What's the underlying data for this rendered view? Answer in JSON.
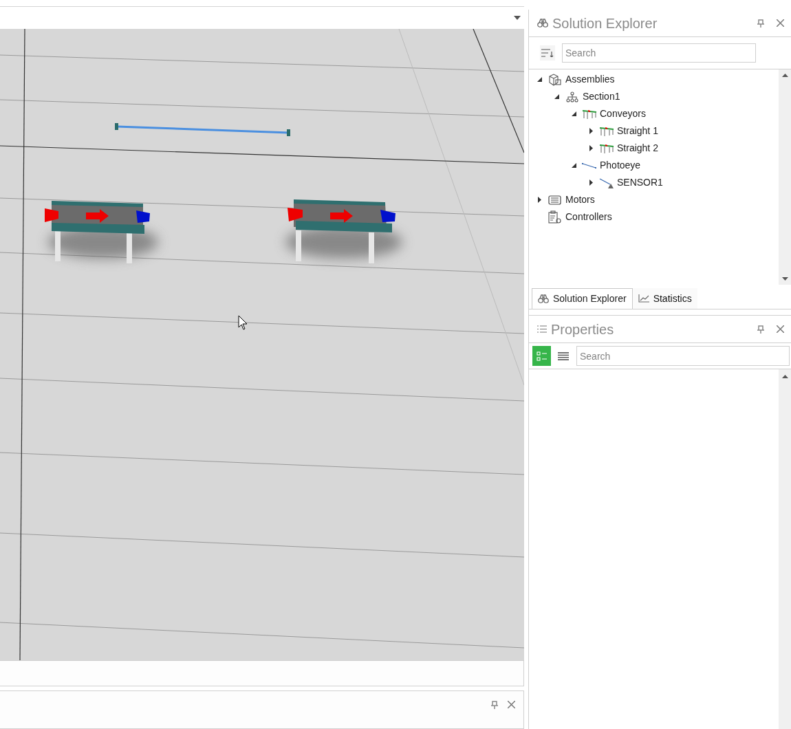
{
  "solution_explorer": {
    "title": "Solution Explorer",
    "search": {
      "placeholder": "Search"
    },
    "tree": [
      {
        "label": "Assemblies",
        "kind": "assembly",
        "expanded": true,
        "children": [
          {
            "label": "Section1",
            "kind": "section",
            "expanded": true,
            "children": [
              {
                "label": "Conveyors",
                "kind": "conveyor",
                "expanded": true,
                "children": [
                  {
                    "label": "Straight 1",
                    "kind": "conveyor",
                    "expanded": false
                  },
                  {
                    "label": "Straight 2",
                    "kind": "conveyor",
                    "expanded": false
                  }
                ]
              },
              {
                "label": "Photoeye",
                "kind": "photoeye",
                "expanded": true,
                "children": [
                  {
                    "label": "SENSOR1",
                    "kind": "sensor",
                    "expanded": false
                  }
                ]
              }
            ]
          }
        ]
      },
      {
        "label": "Motors",
        "kind": "motor",
        "expanded": false
      },
      {
        "label": "Controllers",
        "kind": "controller"
      }
    ],
    "tabs": [
      {
        "label": "Solution Explorer",
        "kind": "explorer",
        "selected": true
      },
      {
        "label": "Statistics",
        "kind": "statistics",
        "selected": false
      }
    ]
  },
  "properties": {
    "title": "Properties",
    "view_buttons": [
      {
        "kind": "categorized",
        "selected": true
      },
      {
        "kind": "list",
        "selected": false
      }
    ],
    "search": {
      "placeholder": "Search"
    }
  }
}
